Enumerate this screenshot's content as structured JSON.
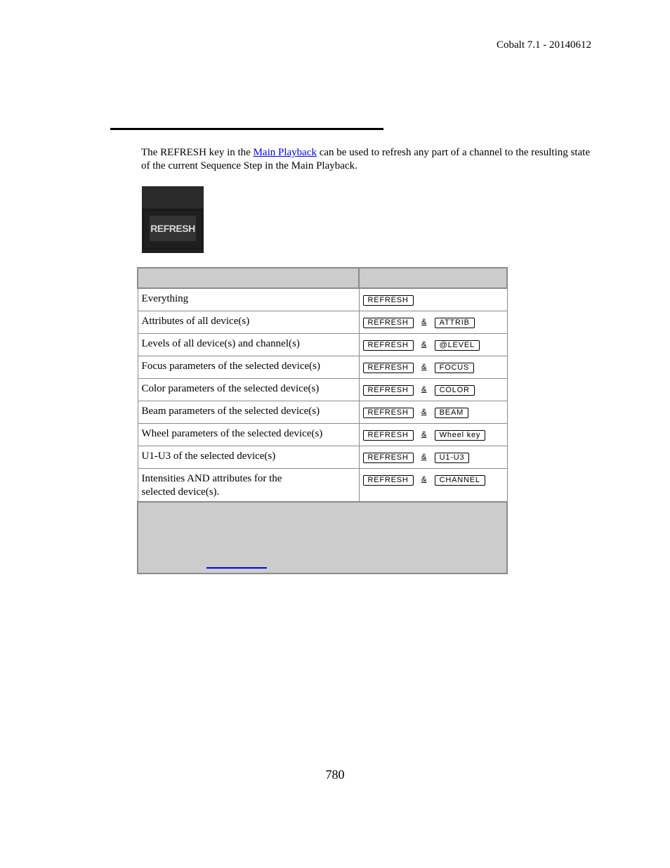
{
  "header": {
    "version": "Cobalt 7.1 - 20140612"
  },
  "intro": {
    "before_link": "The REFRESH key in the ",
    "link_text": "Main Playback",
    "after_link": " can be used to refresh any part of a channel to the resulting state of the current Sequence Step in the Main Playback."
  },
  "key_image": {
    "label": "REFRESH"
  },
  "table": {
    "headers": [
      "",
      ""
    ],
    "connector": "&",
    "rows": [
      {
        "action": "Everything",
        "keys": [
          "REFRESH"
        ]
      },
      {
        "action": "Attributes of all device(s)",
        "keys": [
          "REFRESH",
          "ATTRIB"
        ]
      },
      {
        "action": "Levels of all device(s) and channel(s)",
        "keys": [
          "REFRESH",
          "@LEVEL"
        ]
      },
      {
        "action": "Focus parameters of the selected device(s)",
        "keys": [
          "REFRESH",
          "FOCUS"
        ]
      },
      {
        "action": "Color parameters of the selected device(s)",
        "keys": [
          "REFRESH",
          "COLOR"
        ]
      },
      {
        "action": "Beam parameters of the selected device(s)",
        "keys": [
          "REFRESH",
          "BEAM"
        ]
      },
      {
        "action": "Wheel parameters of the selected device(s)",
        "keys": [
          "REFRESH",
          "Wheel key"
        ]
      },
      {
        "action": "U1-U3 of the selected device(s)",
        "keys": [
          "REFRESH",
          "U1-U3"
        ]
      },
      {
        "action_line1": "Intensities AND attributes for the",
        "action_line2": "selected device(s).",
        "keys": [
          "REFRESH",
          "CHANNEL"
        ]
      }
    ],
    "note_link_text": ""
  },
  "footer": {
    "page_number": "780"
  }
}
